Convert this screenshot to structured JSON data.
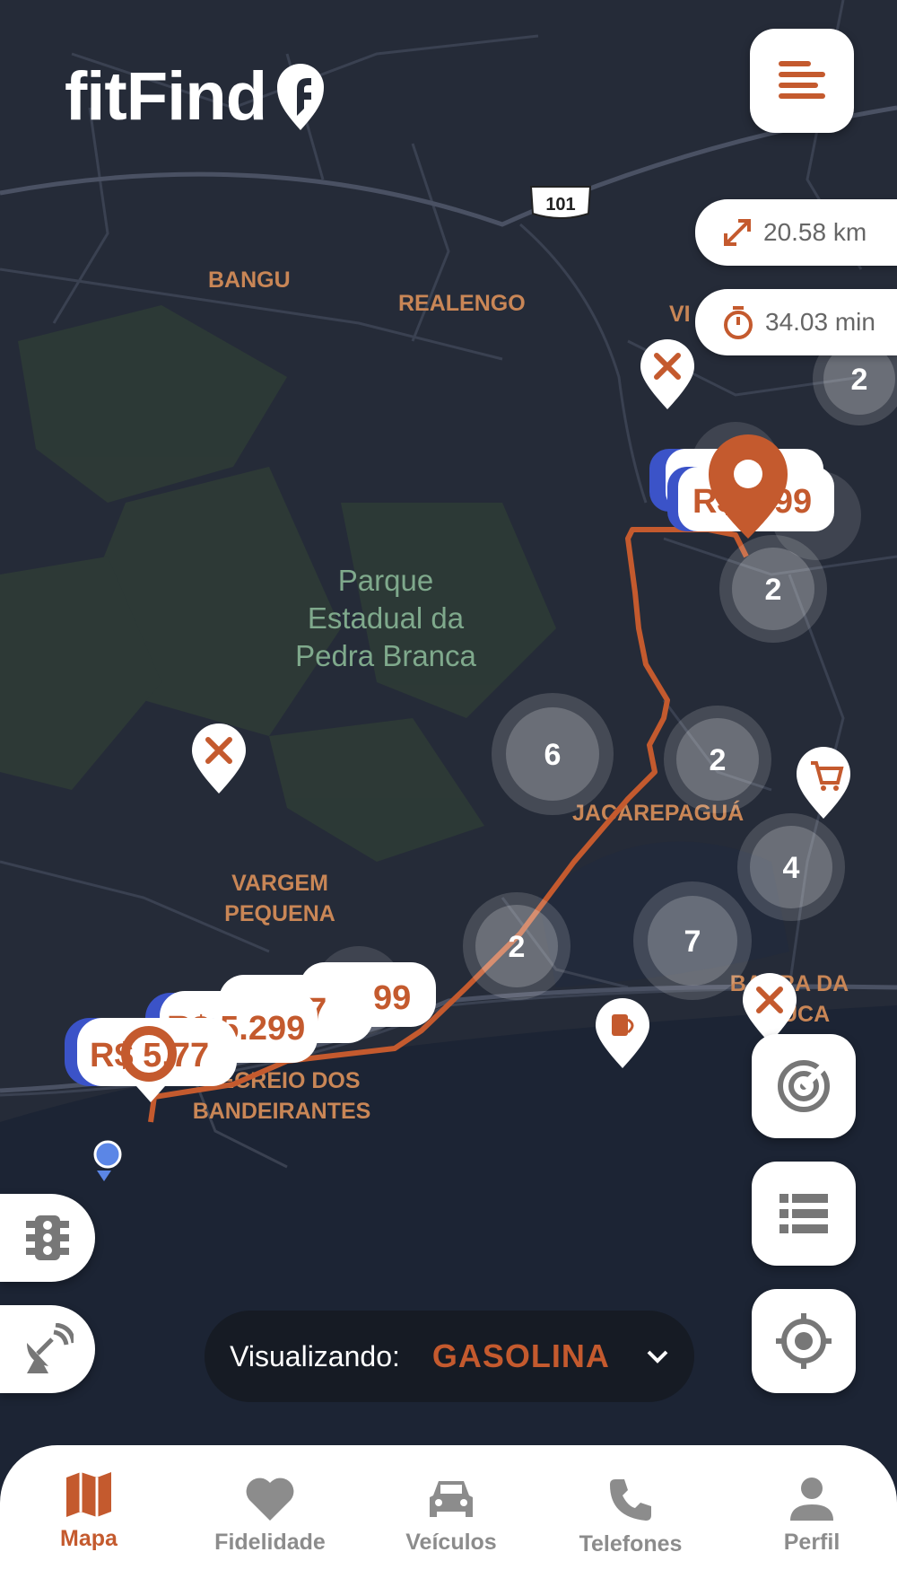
{
  "app": {
    "logo_text": "fitFind"
  },
  "route_info": {
    "distance": "20.58 km",
    "duration": "34.03 min"
  },
  "map": {
    "park_label_lines": [
      "Parque",
      "Estadual da",
      "Pedra Branca"
    ],
    "neighborhoods": {
      "bangu": "BANGU",
      "realengo": "REALENGO",
      "vila_partial": "VI",
      "jacarepagua": "JACAREPAGUÁ",
      "vargem_line1": "VARGEM",
      "vargem_line2": "PEQUENA",
      "recreio_line1": "RECREIO DOS",
      "recreio_line2": "BANDEIRANTES",
      "barra_line1": "BARRA DA",
      "barra_line2": "TIJUCA"
    },
    "highway_shield": "101",
    "clusters": [
      "2",
      "2",
      "6",
      "2",
      "4",
      "2",
      "7"
    ],
    "price_markers": [
      "R$ 5.99",
      "99",
      "77",
      "R$ 5.299",
      "R$ 5.77"
    ]
  },
  "viewing": {
    "label": "Visualizando:",
    "fuel": "GASOLINA"
  },
  "nav": {
    "items": [
      {
        "label": "Mapa",
        "icon": "map-icon",
        "active": true
      },
      {
        "label": "Fidelidade",
        "icon": "heart-icon",
        "active": false
      },
      {
        "label": "Veículos",
        "icon": "car-icon",
        "active": false
      },
      {
        "label": "Telefones",
        "icon": "phone-icon",
        "active": false
      },
      {
        "label": "Perfil",
        "icon": "person-icon",
        "active": false
      }
    ]
  },
  "colors": {
    "accent": "#c45a2e",
    "map_bg": "#252b38",
    "roads": "#3a4151",
    "water": "#1c2434"
  }
}
